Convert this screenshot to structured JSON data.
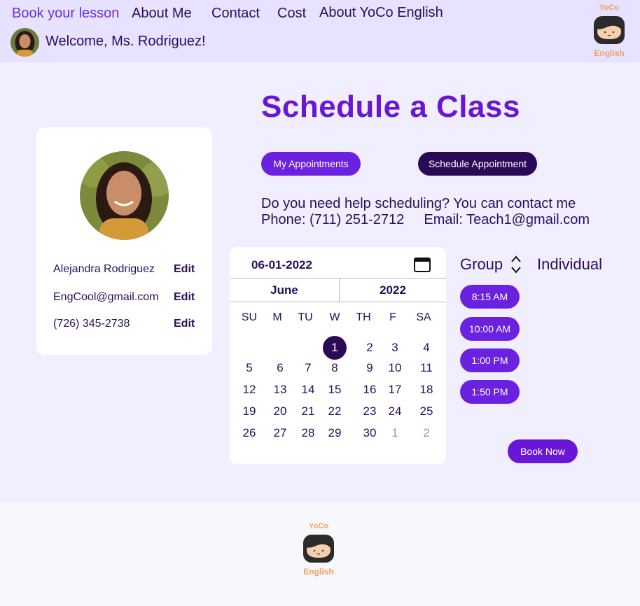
{
  "nav": {
    "items": [
      "Book your lesson",
      "About Me",
      "Contact",
      "Cost",
      "About YoCo English"
    ],
    "welcome": "Welcome, Ms. Rodriguez!"
  },
  "logo": {
    "top": "YoCo",
    "bottom": "English"
  },
  "page": {
    "title": "Schedule a Class"
  },
  "profile": {
    "name": "Alejandra Rodriguez",
    "email": "EngCool@gmail.com",
    "phone": "(726) 345-2738",
    "edit_label": "Edit"
  },
  "buttons": {
    "my_appointments": "My Appointments",
    "schedule_appointment": "Schedule Appointment",
    "book_now": "Book Now"
  },
  "help": {
    "line1": "Do you need help scheduling? You can contact me",
    "phone": "Phone: (711) 251-2712",
    "email": "Email: Teach1@gmail.com"
  },
  "calendar": {
    "date_value": "06-01-2022",
    "month": "June",
    "year": "2022",
    "weekdays": [
      "SU",
      "M",
      "TU",
      "W",
      "TH",
      "F",
      "SA"
    ],
    "selected_day": "1",
    "next_month_days": [
      "1",
      "2"
    ]
  },
  "session_type": {
    "group": "Group",
    "individual": "Individual"
  },
  "times": [
    "8:15 AM",
    "10:00 AM",
    "1:00 PM",
    "1:50 PM"
  ],
  "colors": {
    "accent": "#6a16d8",
    "button": "#6a22e0",
    "dark_button": "#2a0a56",
    "header_bg": "#e6e2ff",
    "page_bg": "#f0eeff"
  }
}
